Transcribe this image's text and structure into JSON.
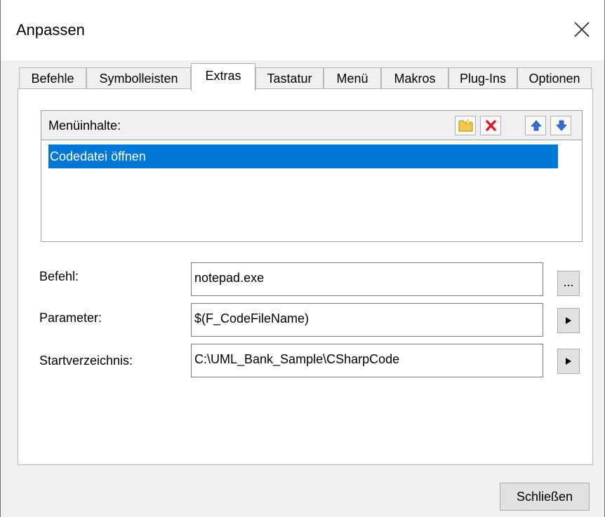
{
  "window": {
    "title": "Anpassen"
  },
  "tabs": [
    {
      "label": "Befehle"
    },
    {
      "label": "Symbolleisten"
    },
    {
      "label": "Extras"
    },
    {
      "label": "Tastatur"
    },
    {
      "label": "Menü"
    },
    {
      "label": "Makros"
    },
    {
      "label": "Plug-Ins"
    },
    {
      "label": "Optionen"
    }
  ],
  "active_tab": "Extras",
  "menu_contents": {
    "label": "Menüinhalte:",
    "items": [
      {
        "label": "Codedatei öffnen",
        "selected": true
      }
    ],
    "toolbar_icons": [
      "new-folder-icon",
      "delete-icon",
      "move-up-icon",
      "move-down-icon"
    ]
  },
  "fields": {
    "command": {
      "label": "Befehl:",
      "value": "notepad.exe",
      "button_label": "..."
    },
    "parameter": {
      "label": "Parameter:",
      "value": "$(F_CodeFileName)"
    },
    "start_dir": {
      "label": "Startverzeichnis:",
      "value": "C:\\UML_Bank_Sample\\CSharpCode"
    }
  },
  "footer": {
    "close_label": "Schließen"
  },
  "colors": {
    "selection": "#0078d7",
    "delete_red": "#e81123",
    "arrow_blue": "#2f6fd6"
  }
}
